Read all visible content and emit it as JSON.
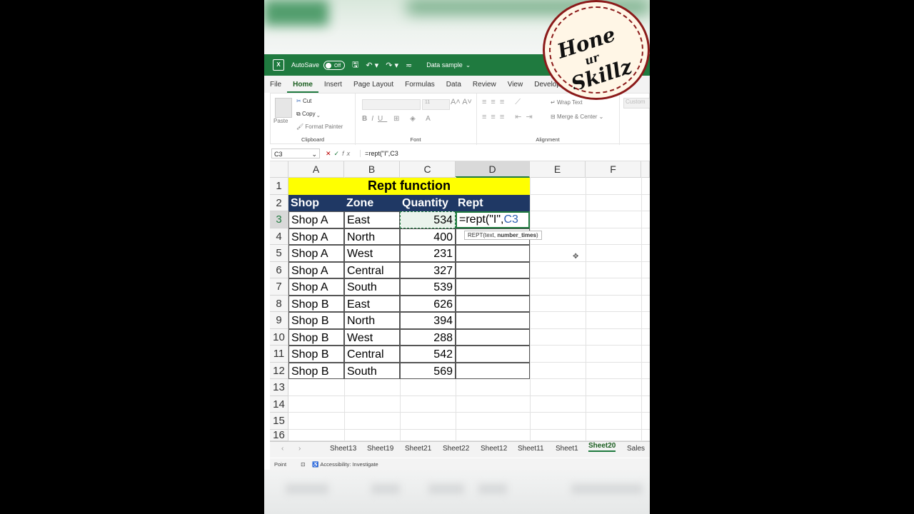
{
  "titlebar": {
    "autosave_label": "AutoSave",
    "toggle_state": "Off",
    "doc_name": "Data sample"
  },
  "menu": {
    "items": [
      "File",
      "Home",
      "Insert",
      "Page Layout",
      "Formulas",
      "Data",
      "Review",
      "View",
      "Developer"
    ],
    "active": "Home"
  },
  "ribbon": {
    "clipboard": {
      "paste": "Paste",
      "cut": "Cut",
      "copy": "Copy",
      "format_painter": "Format Painter",
      "label": "Clipboard"
    },
    "font": {
      "label": "Font",
      "size": "11"
    },
    "alignment": {
      "wrap_text": "Wrap Text",
      "merge_center": "Merge & Center",
      "label": "Alignment"
    },
    "number": {
      "format": "Custom"
    }
  },
  "formula_bar": {
    "name_box": "C3",
    "formula": "=rept(\"I\",C3"
  },
  "columns": [
    "A",
    "B",
    "C",
    "D",
    "E",
    "F"
  ],
  "rows": [
    "1",
    "2",
    "3",
    "4",
    "5",
    "6",
    "7",
    "8",
    "9",
    "10",
    "11",
    "12",
    "13",
    "14",
    "15",
    "16"
  ],
  "sheet": {
    "title": "Rept function",
    "headers": [
      "Shop",
      "Zone",
      "Quantity",
      "Rept"
    ],
    "data": [
      {
        "shop": "Shop A",
        "zone": "East",
        "qty": "534"
      },
      {
        "shop": "Shop A",
        "zone": "North",
        "qty": "400"
      },
      {
        "shop": "Shop A",
        "zone": "West",
        "qty": "231"
      },
      {
        "shop": "Shop A",
        "zone": "Central",
        "qty": "327"
      },
      {
        "shop": "Shop A",
        "zone": "South",
        "qty": "539"
      },
      {
        "shop": "Shop B",
        "zone": "East",
        "qty": "626"
      },
      {
        "shop": "Shop B",
        "zone": "North",
        "qty": "394"
      },
      {
        "shop": "Shop B",
        "zone": "West",
        "qty": "288"
      },
      {
        "shop": "Shop B",
        "zone": "Central",
        "qty": "542"
      },
      {
        "shop": "Shop B",
        "zone": "South",
        "qty": "569"
      }
    ],
    "edit_cell": {
      "prefix": "=rept(\"I\",",
      "ref": "C3"
    },
    "tooltip": {
      "fn": "REPT(text, ",
      "arg": "number_times",
      "close": ")"
    }
  },
  "tabs": [
    "Sheet13",
    "Sheet19",
    "Sheet21",
    "Sheet22",
    "Sheet12",
    "Sheet11",
    "Sheet1",
    "Sheet20",
    "Sales"
  ],
  "active_tab": "Sheet20",
  "status": {
    "mode": "Point",
    "accessibility": "Accessibility: Investigate"
  },
  "watermark": {
    "text": "Hone ur Skillz"
  },
  "colors": {
    "excel_green": "#1f7a3f",
    "title_fill": "#ffff00",
    "header_fill": "#1f3864"
  }
}
